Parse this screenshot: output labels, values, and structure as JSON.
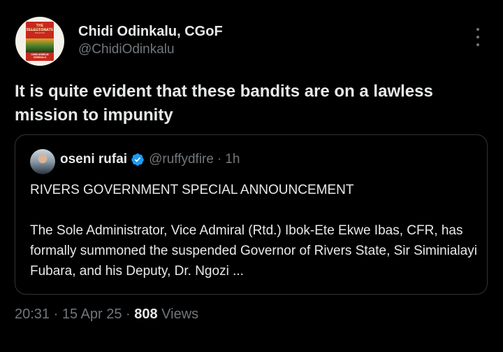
{
  "author": {
    "name": "Chidi Odinkalu, CGoF",
    "handle": "@ChidiOdinkalu",
    "avatar": {
      "book_title": "THE SELECTORATE",
      "book_subtitle": "NIGERIA'S MONEY-POLITICS",
      "book_author": "CHIDI ANSELM ODINKALU"
    }
  },
  "tweet": {
    "text": "It is quite evident that these bandits are on a lawless mission to impunity"
  },
  "quoted": {
    "name": "oseni rufai",
    "handle": "@ruffydfire",
    "separator": "·",
    "time": "1h",
    "headline": "RIVERS GOVERNMENT SPECIAL ANNOUNCEMENT",
    "body": "The Sole Administrator, Vice Admiral (Rtd.) Ibok-Ete Ekwe Ibas, CFR, has formally summoned the suspended Governor of Rivers State, Sir Siminialayi Fubara, and his Deputy, Dr. Ngozi ..."
  },
  "meta": {
    "time": "20:31",
    "sep1": " · ",
    "date": "15 Apr 25",
    "sep2": " · ",
    "views": "808",
    "views_label": " Views"
  },
  "colors": {
    "background": "#000000",
    "text": "#e7e9ea",
    "muted": "#71767b",
    "border": "#2f3336",
    "verified": "#1d9bf0"
  },
  "icons": {
    "more": "more-vertical-icon",
    "verified": "verified-badge-icon"
  }
}
